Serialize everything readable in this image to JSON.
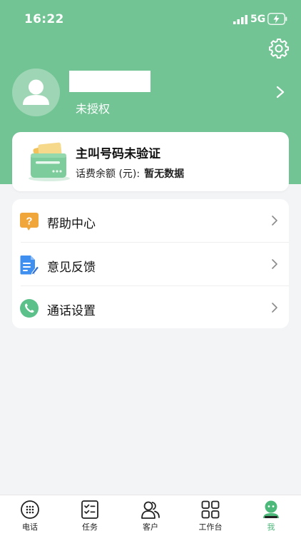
{
  "status_bar": {
    "time": "16:22",
    "network": "5G"
  },
  "profile": {
    "auth_status": "未授权"
  },
  "card": {
    "title": "主叫号码未验证",
    "balance_label": "话费余额 (元):",
    "balance_value": "暂无数据"
  },
  "menu": {
    "items": [
      {
        "label": "帮助中心",
        "icon": "help-icon"
      },
      {
        "label": "意见反馈",
        "icon": "feedback-icon"
      },
      {
        "label": "通话设置",
        "icon": "phone-icon"
      }
    ]
  },
  "tabbar": {
    "items": [
      {
        "label": "电话",
        "icon": "dialpad-icon"
      },
      {
        "label": "任务",
        "icon": "task-icon"
      },
      {
        "label": "客户",
        "icon": "customers-icon"
      },
      {
        "label": "工作台",
        "icon": "workbench-icon"
      },
      {
        "label": "我",
        "icon": "me-icon",
        "active": true
      }
    ]
  },
  "colors": {
    "brand_green": "#72c495",
    "active_tab": "#4cb97a",
    "help_icon": "#f0a63a",
    "feedback_icon": "#3f8ff0",
    "phone_icon": "#5cc08b"
  }
}
